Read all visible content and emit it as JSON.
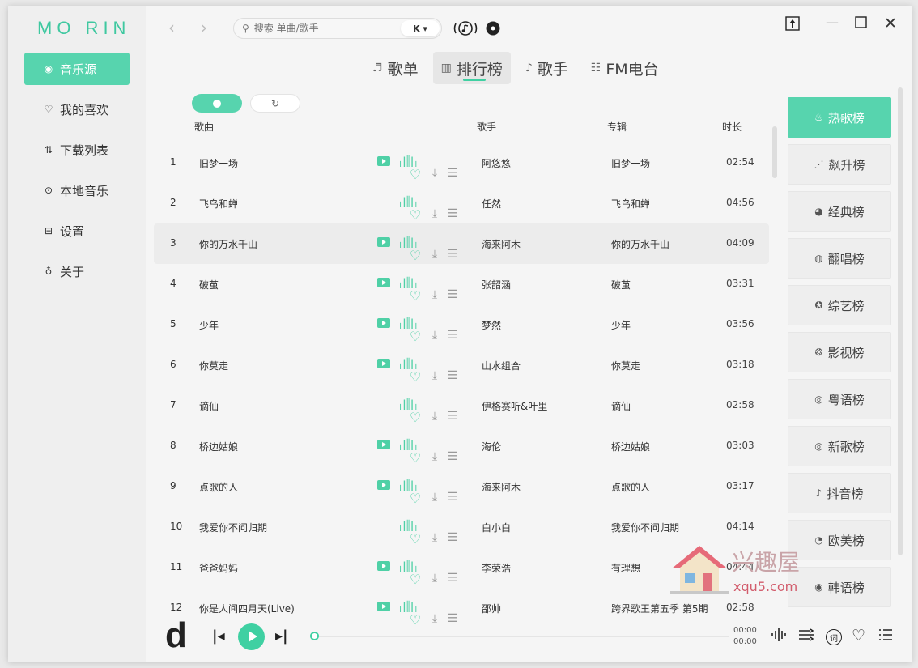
{
  "app": {
    "logo": "MO RIN"
  },
  "sidebar": {
    "items": [
      {
        "label": "音乐源",
        "icon": "disc-icon",
        "glyph": "◉",
        "active": true
      },
      {
        "label": "我的喜欢",
        "icon": "heart-icon",
        "glyph": "♡",
        "active": false
      },
      {
        "label": "下载列表",
        "icon": "sort-icon",
        "glyph": "⇅",
        "active": false
      },
      {
        "label": "本地音乐",
        "icon": "play-circle-icon",
        "glyph": "⊙",
        "active": false
      },
      {
        "label": "设置",
        "icon": "settings-icon",
        "glyph": "⊟",
        "active": false
      },
      {
        "label": "关于",
        "icon": "bulb-icon",
        "glyph": "♁",
        "active": false
      }
    ]
  },
  "search": {
    "placeholder": "搜索 单曲/歌手",
    "source": "K ▾"
  },
  "tabs": [
    {
      "label": "歌单",
      "icon": "playlist-icon",
      "glyph": "♬",
      "active": false
    },
    {
      "label": "排行榜",
      "icon": "chart-icon",
      "glyph": "▥",
      "active": true
    },
    {
      "label": "歌手",
      "icon": "singer-icon",
      "glyph": "♪",
      "active": false
    },
    {
      "label": "FM电台",
      "icon": "radio-icon",
      "glyph": "☷",
      "active": false
    }
  ],
  "table": {
    "headers": {
      "title": "歌曲",
      "artist": "歌手",
      "album": "专辑",
      "duration": "时长"
    },
    "rows": [
      {
        "idx": "1",
        "title": "旧梦一场",
        "artist": "阿悠悠",
        "album": "旧梦一场",
        "duration": "02:54",
        "mv": true
      },
      {
        "idx": "2",
        "title": "飞鸟和蝉",
        "artist": "任然",
        "album": "飞鸟和蝉",
        "duration": "04:56",
        "mv": false
      },
      {
        "idx": "3",
        "title": "你的万水千山",
        "artist": "海来阿木",
        "album": "你的万水千山",
        "duration": "04:09",
        "mv": true
      },
      {
        "idx": "4",
        "title": "破茧",
        "artist": "张韶涵",
        "album": "破茧",
        "duration": "03:31",
        "mv": true
      },
      {
        "idx": "5",
        "title": "少年",
        "artist": "梦然",
        "album": "少年",
        "duration": "03:56",
        "mv": true
      },
      {
        "idx": "6",
        "title": "你莫走",
        "artist": "山水组合",
        "album": "你莫走",
        "duration": "03:18",
        "mv": true
      },
      {
        "idx": "7",
        "title": "谪仙",
        "artist": "伊格赛听&叶里",
        "album": "谪仙",
        "duration": "02:58",
        "mv": false
      },
      {
        "idx": "8",
        "title": "桥边姑娘",
        "artist": "海伦",
        "album": "桥边姑娘",
        "duration": "03:03",
        "mv": true
      },
      {
        "idx": "9",
        "title": "点歌的人",
        "artist": "海来阿木",
        "album": "点歌的人",
        "duration": "03:17",
        "mv": true
      },
      {
        "idx": "10",
        "title": "我爱你不问归期",
        "artist": "白小白",
        "album": "我爱你不问归期",
        "duration": "04:14",
        "mv": false
      },
      {
        "idx": "11",
        "title": "爸爸妈妈",
        "artist": "李荣浩",
        "album": "有理想",
        "duration": "04:44",
        "mv": true
      },
      {
        "idx": "12",
        "title": "你是人间四月天(Live)",
        "artist": "邵帅",
        "album": "跨界歌王第五季 第5期",
        "duration": "02:58",
        "mv": true
      }
    ]
  },
  "ranks": [
    {
      "label": "热歌榜",
      "icon": "fire-icon",
      "glyph": "♨",
      "active": true
    },
    {
      "label": "飙升榜",
      "icon": "rise-icon",
      "glyph": "⋰",
      "active": false
    },
    {
      "label": "经典榜",
      "icon": "classic-icon",
      "glyph": "◕",
      "active": false
    },
    {
      "label": "翻唱榜",
      "icon": "mic-icon",
      "glyph": "◍",
      "active": false
    },
    {
      "label": "综艺榜",
      "icon": "star-icon",
      "glyph": "✪",
      "active": false
    },
    {
      "label": "影视榜",
      "icon": "film-icon",
      "glyph": "❂",
      "active": false
    },
    {
      "label": "粤语榜",
      "icon": "cantonese-icon",
      "glyph": "◎",
      "active": false
    },
    {
      "label": "新歌榜",
      "icon": "new-icon",
      "glyph": "◎",
      "active": false
    },
    {
      "label": "抖音榜",
      "icon": "tiktok-icon",
      "glyph": "♪",
      "active": false
    },
    {
      "label": "欧美榜",
      "icon": "globe-icon",
      "glyph": "◔",
      "active": false
    },
    {
      "label": "韩语榜",
      "icon": "korean-icon",
      "glyph": "◉",
      "active": false
    }
  ],
  "player": {
    "logo": "d",
    "time_current": "00:00",
    "time_total": "00:00",
    "lyric_label": "词"
  },
  "watermark": {
    "text": "兴趣屋",
    "url": "xqu5.com"
  }
}
